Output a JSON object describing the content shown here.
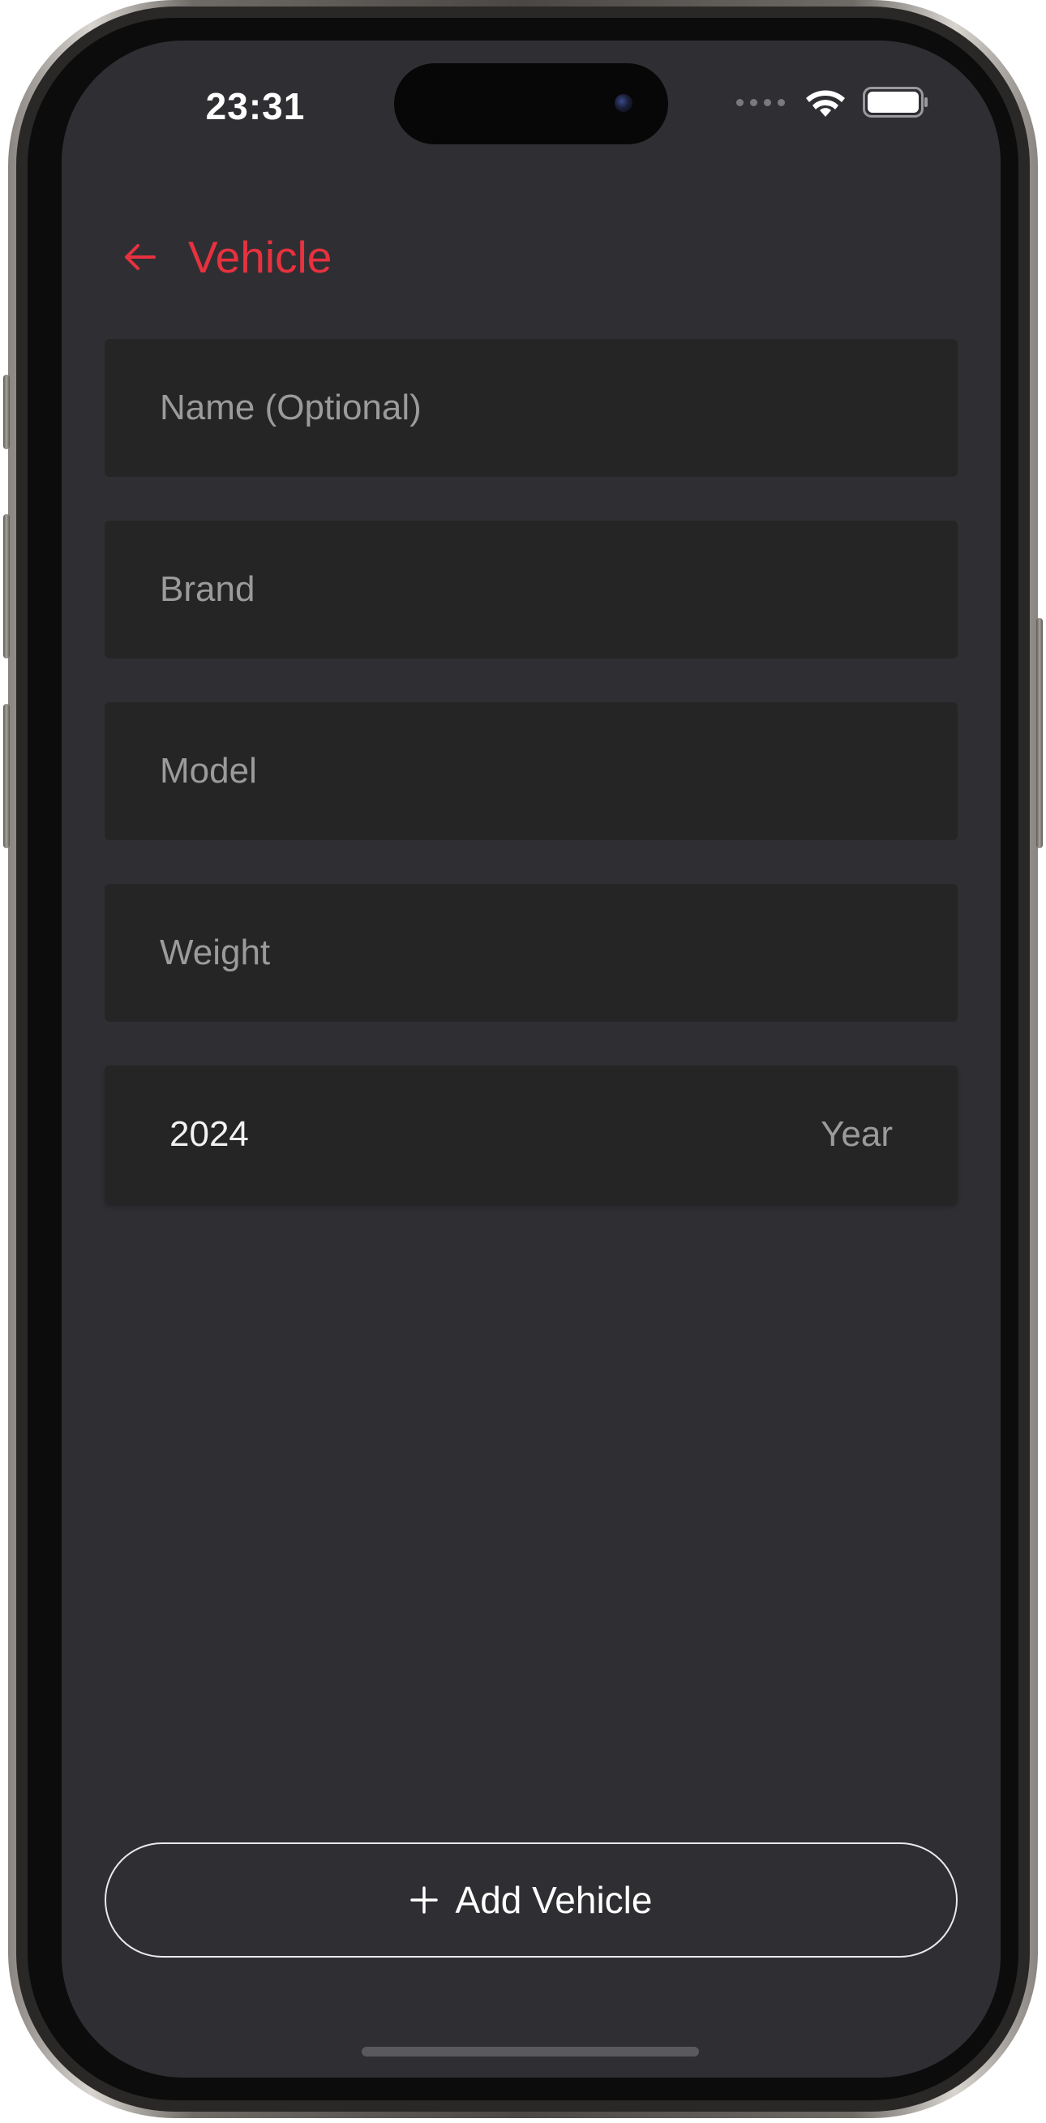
{
  "status_bar": {
    "time": "23:31",
    "icons": [
      "signal-dots-icon",
      "wifi-icon",
      "battery-icon"
    ]
  },
  "header": {
    "back_icon": "arrow-left-icon",
    "title": "Vehicle",
    "accent_color": "#e8313f"
  },
  "form": {
    "name_placeholder": "Name (Optional)",
    "brand_placeholder": "Brand",
    "model_placeholder": "Model",
    "weight_placeholder": "Weight",
    "year_value": "2024",
    "year_label": "Year"
  },
  "actions": {
    "add_icon": "plus-icon",
    "add_label": "Add Vehicle"
  },
  "colors": {
    "screen_background": "#2f2f33",
    "field_background": "#252525",
    "placeholder_text": "#9b9b9b"
  }
}
